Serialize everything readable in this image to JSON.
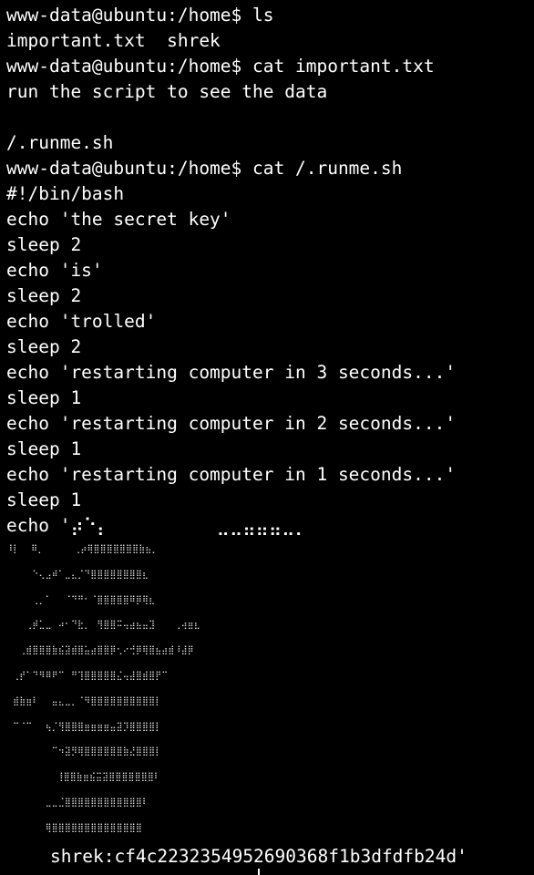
{
  "terminal": {
    "lines": [
      "www-data@ubuntu:/home$ ls",
      "important.txt  shrek",
      "www-data@ubuntu:/home$ cat important.txt",
      "run the script to see the data",
      "",
      "/.runme.sh",
      "www-data@ubuntu:/home$ cat /.runme.sh",
      "#!/bin/bash",
      "echo 'the secret key'",
      "sleep 2",
      "echo 'is'",
      "sleep 2",
      "echo 'trolled'",
      "sleep 2",
      "echo 'restarting computer in 3 seconds...'",
      "sleep 1",
      "echo 'restarting computer in 2 seconds...'",
      "sleep 1",
      "echo 'restarting computer in 1 seconds...'",
      "sleep 1"
    ],
    "art_start_line": "echo '⡴⠑⡄          ⣀⣀⣤⣤⣤⣀⡀",
    "art_lines": [
      "⠸⡇ ⠀⠿⡀ ⠀ ⠀⠀⢀⡴⢿⣿⣿⣿⣿⣿⣿⣿⣷⣦⡀",
      "⠀⠀⠀⠀⠑⢄⣠⠾⠁⣀⣄⡈⠙⣿⣿⣿⣿⣿⣿⣿⣿⣆",
      "⠀⠀⠀⠀⢀⡀⠁⠀⠀⠈⠙⠛⠂⠈⣿⣿⣿⣿⣿⠿⡿⢿⣆",
      "⠀⠀⠀⢀⡾⣁⣀⠀⠴⠂⠙⣗⡀⠀⢻⣿⣿⠭⢤⣴⣦⣤⣹⠀⠀⠀⢀⢴⣶⣆",
      "⠀⠀⢀⣾⣿⣿⣿⣷⣮⣽⣾⣿⣥⣴⣿⣿⡿⢂⠔⢚⡿⢿⣿⣦⣴⣾⠸⣼⡿",
      "⠀⢀⡞⠁⠙⠻⠿⠟⠉⠀⠛⢹⣿⣿⣿⣿⣿⣌⢤⣼⣿⣾⣿⡟⠉",
      "⠀⣾⣷⣶⠇⠀⠀⣤⣄⣀⡀⠈⠻⣿⣿⣿⣿⣿⣿⣿⣿⣿⣿⡇",
      "⠀⠉⠈⠉⠀⠀⢦⡈⢻⣿⣿⣿⣶⣶⣶⣶⣤⣽⡹⣿⣿⣿⣿⡇",
      "⠀⠀⠀⠀⠀⠀⠀⠉⠲⣽⡻⢿⣿⣿⣿⣿⣿⣿⣷⣜⣿⣿⣿⡇",
      "⠀⠀ ⠀⠀⠀⠀⠀⢸⣿⣿⣷⣶⣮⣭⣽⣿⣿⣿⣿⣿⣿⣿⠇",
      "⠀⠀⠀⠀⠀⠀⣀⣀⣈⣿⣿⣿⣿⣿⣿⣿⣿⣿⣿⣿⣿⠇",
      "⠀⠀⠀⠀⠀⠀⢿⣿⣿⣿⣿⣿⣿⣿⣿⣿⣿⣿⣿⣿⣿"
    ],
    "final_line": "shrek:cf4c2232354952690368f1b3dfdfb24d'"
  }
}
